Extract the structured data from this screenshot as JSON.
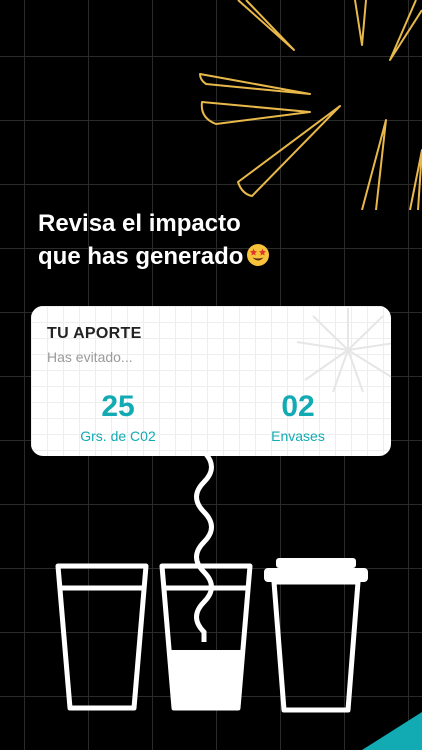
{
  "headline": {
    "line1": "Revisa el impacto",
    "line2": "que has generado",
    "emoji": "star-struck-emoji"
  },
  "card": {
    "title": "TU APORTE",
    "subtitle": "Has evitado...",
    "stats": [
      {
        "value": "25",
        "label": "Grs. de C02"
      },
      {
        "value": "02",
        "label": "Envases"
      }
    ]
  },
  "icons": [
    "starburst-icon",
    "card-starburst-icon",
    "wavy-straw-icon",
    "empty-glass-icon",
    "half-full-glass-icon",
    "takeaway-cup-icon"
  ],
  "colors": {
    "background": "#000000",
    "accent_teal": "#12aab3",
    "starburst_yellow": "#e8b84a",
    "card_background": "#ffffff"
  }
}
